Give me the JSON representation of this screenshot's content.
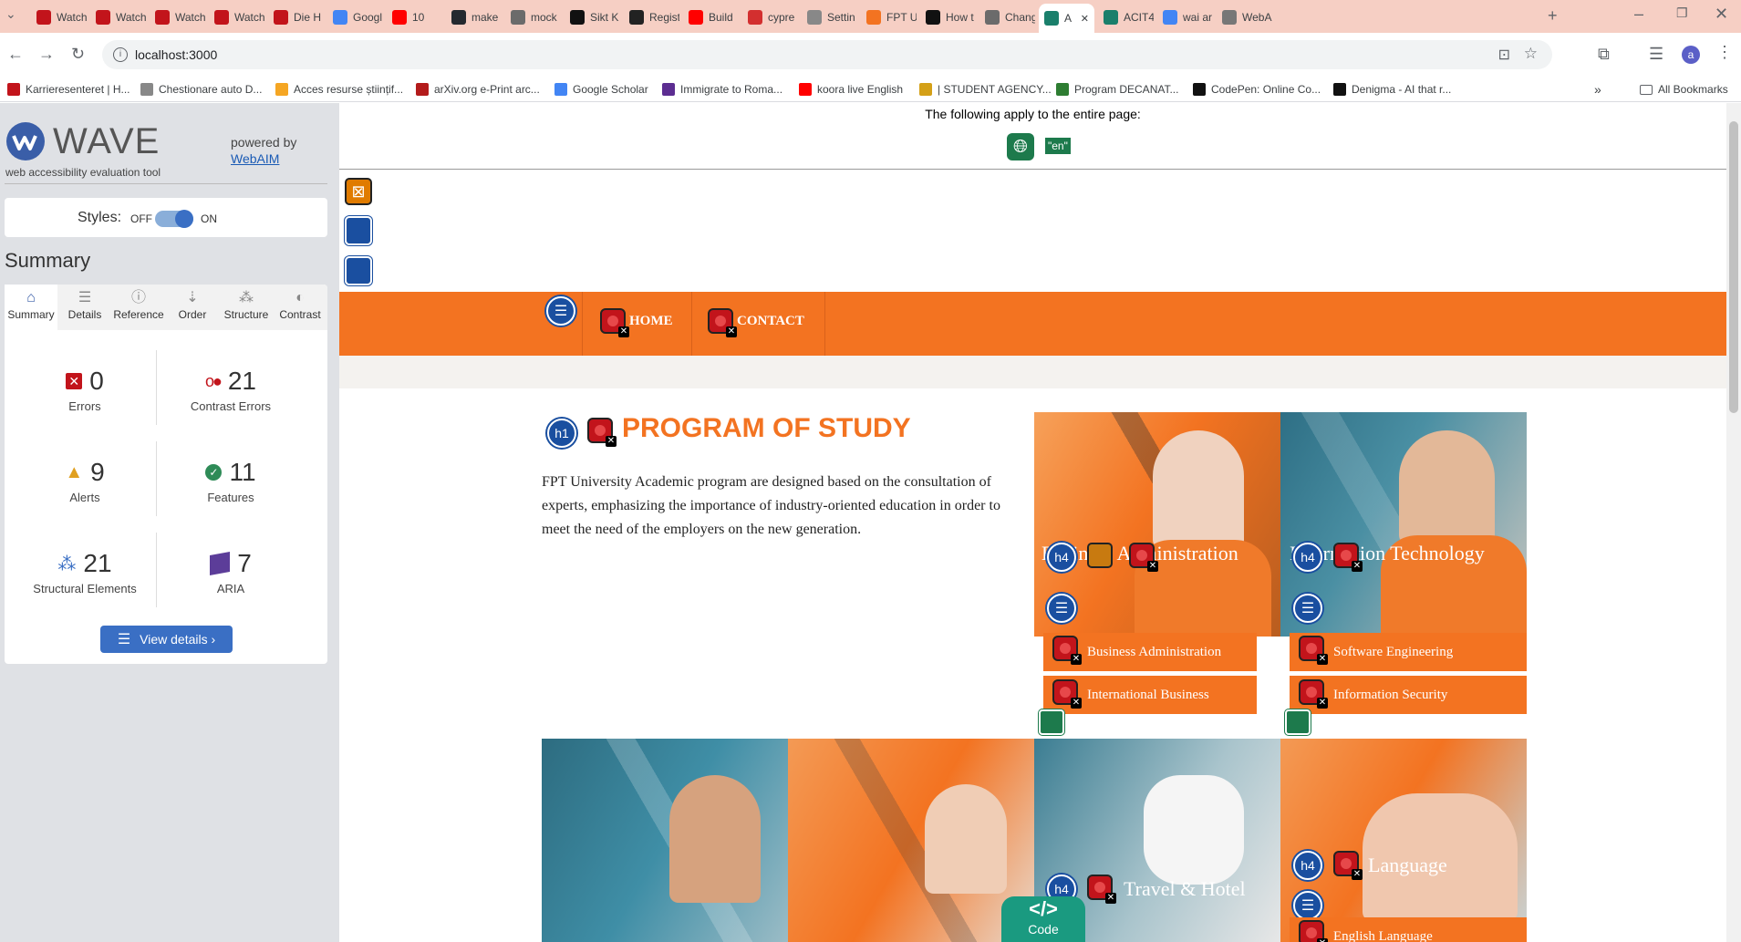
{
  "browser": {
    "tabs": [
      {
        "label": "Watch",
        "color": "#c2141b"
      },
      {
        "label": "Watch",
        "color": "#c2141b"
      },
      {
        "label": "Watch",
        "color": "#c2141b"
      },
      {
        "label": "Watch",
        "color": "#c2141b"
      },
      {
        "label": "Die H",
        "color": "#c2141b"
      },
      {
        "label": "Googl",
        "color": "#4285f4"
      },
      {
        "label": "10",
        "color": "#ff0000"
      },
      {
        "label": "make",
        "color": "#24292f"
      },
      {
        "label": "mock",
        "color": "#6b6b6b"
      },
      {
        "label": "Sikt K",
        "color": "#111111"
      },
      {
        "label": "Regist",
        "color": "#222222"
      },
      {
        "label": "Build",
        "color": "#ff0000"
      },
      {
        "label": "cypre",
        "color": "#d32f2f"
      },
      {
        "label": "Settin",
        "color": "#888888"
      },
      {
        "label": "FPT U",
        "color": "#f37321"
      },
      {
        "label": "How t",
        "color": "#111111"
      },
      {
        "label": "Chang",
        "color": "#6b6b6b"
      },
      {
        "label": "A",
        "color": "#1a7f6b"
      },
      {
        "label": "ACIT4",
        "color": "#1a7f6b"
      },
      {
        "label": "wai ar",
        "color": "#4285f4"
      },
      {
        "label": "WebA",
        "color": "#777777"
      }
    ],
    "url": "localhost:3000",
    "bookmarks": [
      {
        "label": "Karrieresenteret | H...",
        "color": "#c2141b"
      },
      {
        "label": "Chestionare auto D...",
        "color": "#888888"
      },
      {
        "label": "Acces resurse științif...",
        "color": "#f5a623"
      },
      {
        "label": "arXiv.org e-Print arc...",
        "color": "#b31b1b"
      },
      {
        "label": "Google Scholar",
        "color": "#4285f4"
      },
      {
        "label": "Immigrate to Roma...",
        "color": "#5c2d91"
      },
      {
        "label": "koora live English",
        "color": "#ff0000"
      },
      {
        "label": "| STUDENT AGENCY...",
        "color": "#d4a017"
      },
      {
        "label": "Program DECANAT...",
        "color": "#2e7d32"
      },
      {
        "label": "CodePen: Online Co...",
        "color": "#111111"
      },
      {
        "label": "Denigma - AI that r...",
        "color": "#111111"
      }
    ],
    "all_bookmarks": "All Bookmarks",
    "profile_letter": "a"
  },
  "wave": {
    "logo_text": "WAVE",
    "tagline": "web accessibility evaluation tool",
    "powered_by": "powered by",
    "webaim": "WebAIM",
    "styles_label": "Styles:",
    "styles_off": "OFF",
    "styles_on": "ON",
    "summary_heading": "Summary",
    "tabs": [
      "Summary",
      "Details",
      "Reference",
      "Order",
      "Structure",
      "Contrast"
    ],
    "stats": {
      "errors": {
        "value": "0",
        "label": "Errors"
      },
      "contrast": {
        "value": "21",
        "label": "Contrast Errors"
      },
      "alerts": {
        "value": "9",
        "label": "Alerts"
      },
      "features": {
        "value": "11",
        "label": "Features"
      },
      "structural": {
        "value": "21",
        "label": "Structural Elements"
      },
      "aria": {
        "value": "7",
        "label": "ARIA"
      }
    },
    "view_details": "View details ›"
  },
  "page": {
    "entire_page_note": "The following apply to the entire page:",
    "lang_badge": "\"en\"",
    "nav": {
      "home": "HOME",
      "contact": "CONTACT"
    },
    "h1_badge": "h1",
    "h4_badge": "h4",
    "heading": "PROGRAM OF STUDY",
    "intro": "FPT University Academic program are designed based on the consultation of experts, emphasizing the importance of industry-oriented education in order to meet the need of the employers on the new generation.",
    "cards": [
      {
        "title": "Business Administration",
        "items": [
          "Business Administration",
          "International Business"
        ]
      },
      {
        "title": "Information Technology",
        "items": [
          "Software Engineering",
          "Information Security"
        ]
      },
      {
        "title": "Travel & Hotel",
        "items": []
      },
      {
        "title": "Language",
        "items": [
          "English Language"
        ]
      }
    ],
    "code_toggle": "Code"
  },
  "colors": {
    "accent_orange": "#f37321",
    "wave_blue": "#1a4fa0",
    "error_red": "#c2141b"
  }
}
